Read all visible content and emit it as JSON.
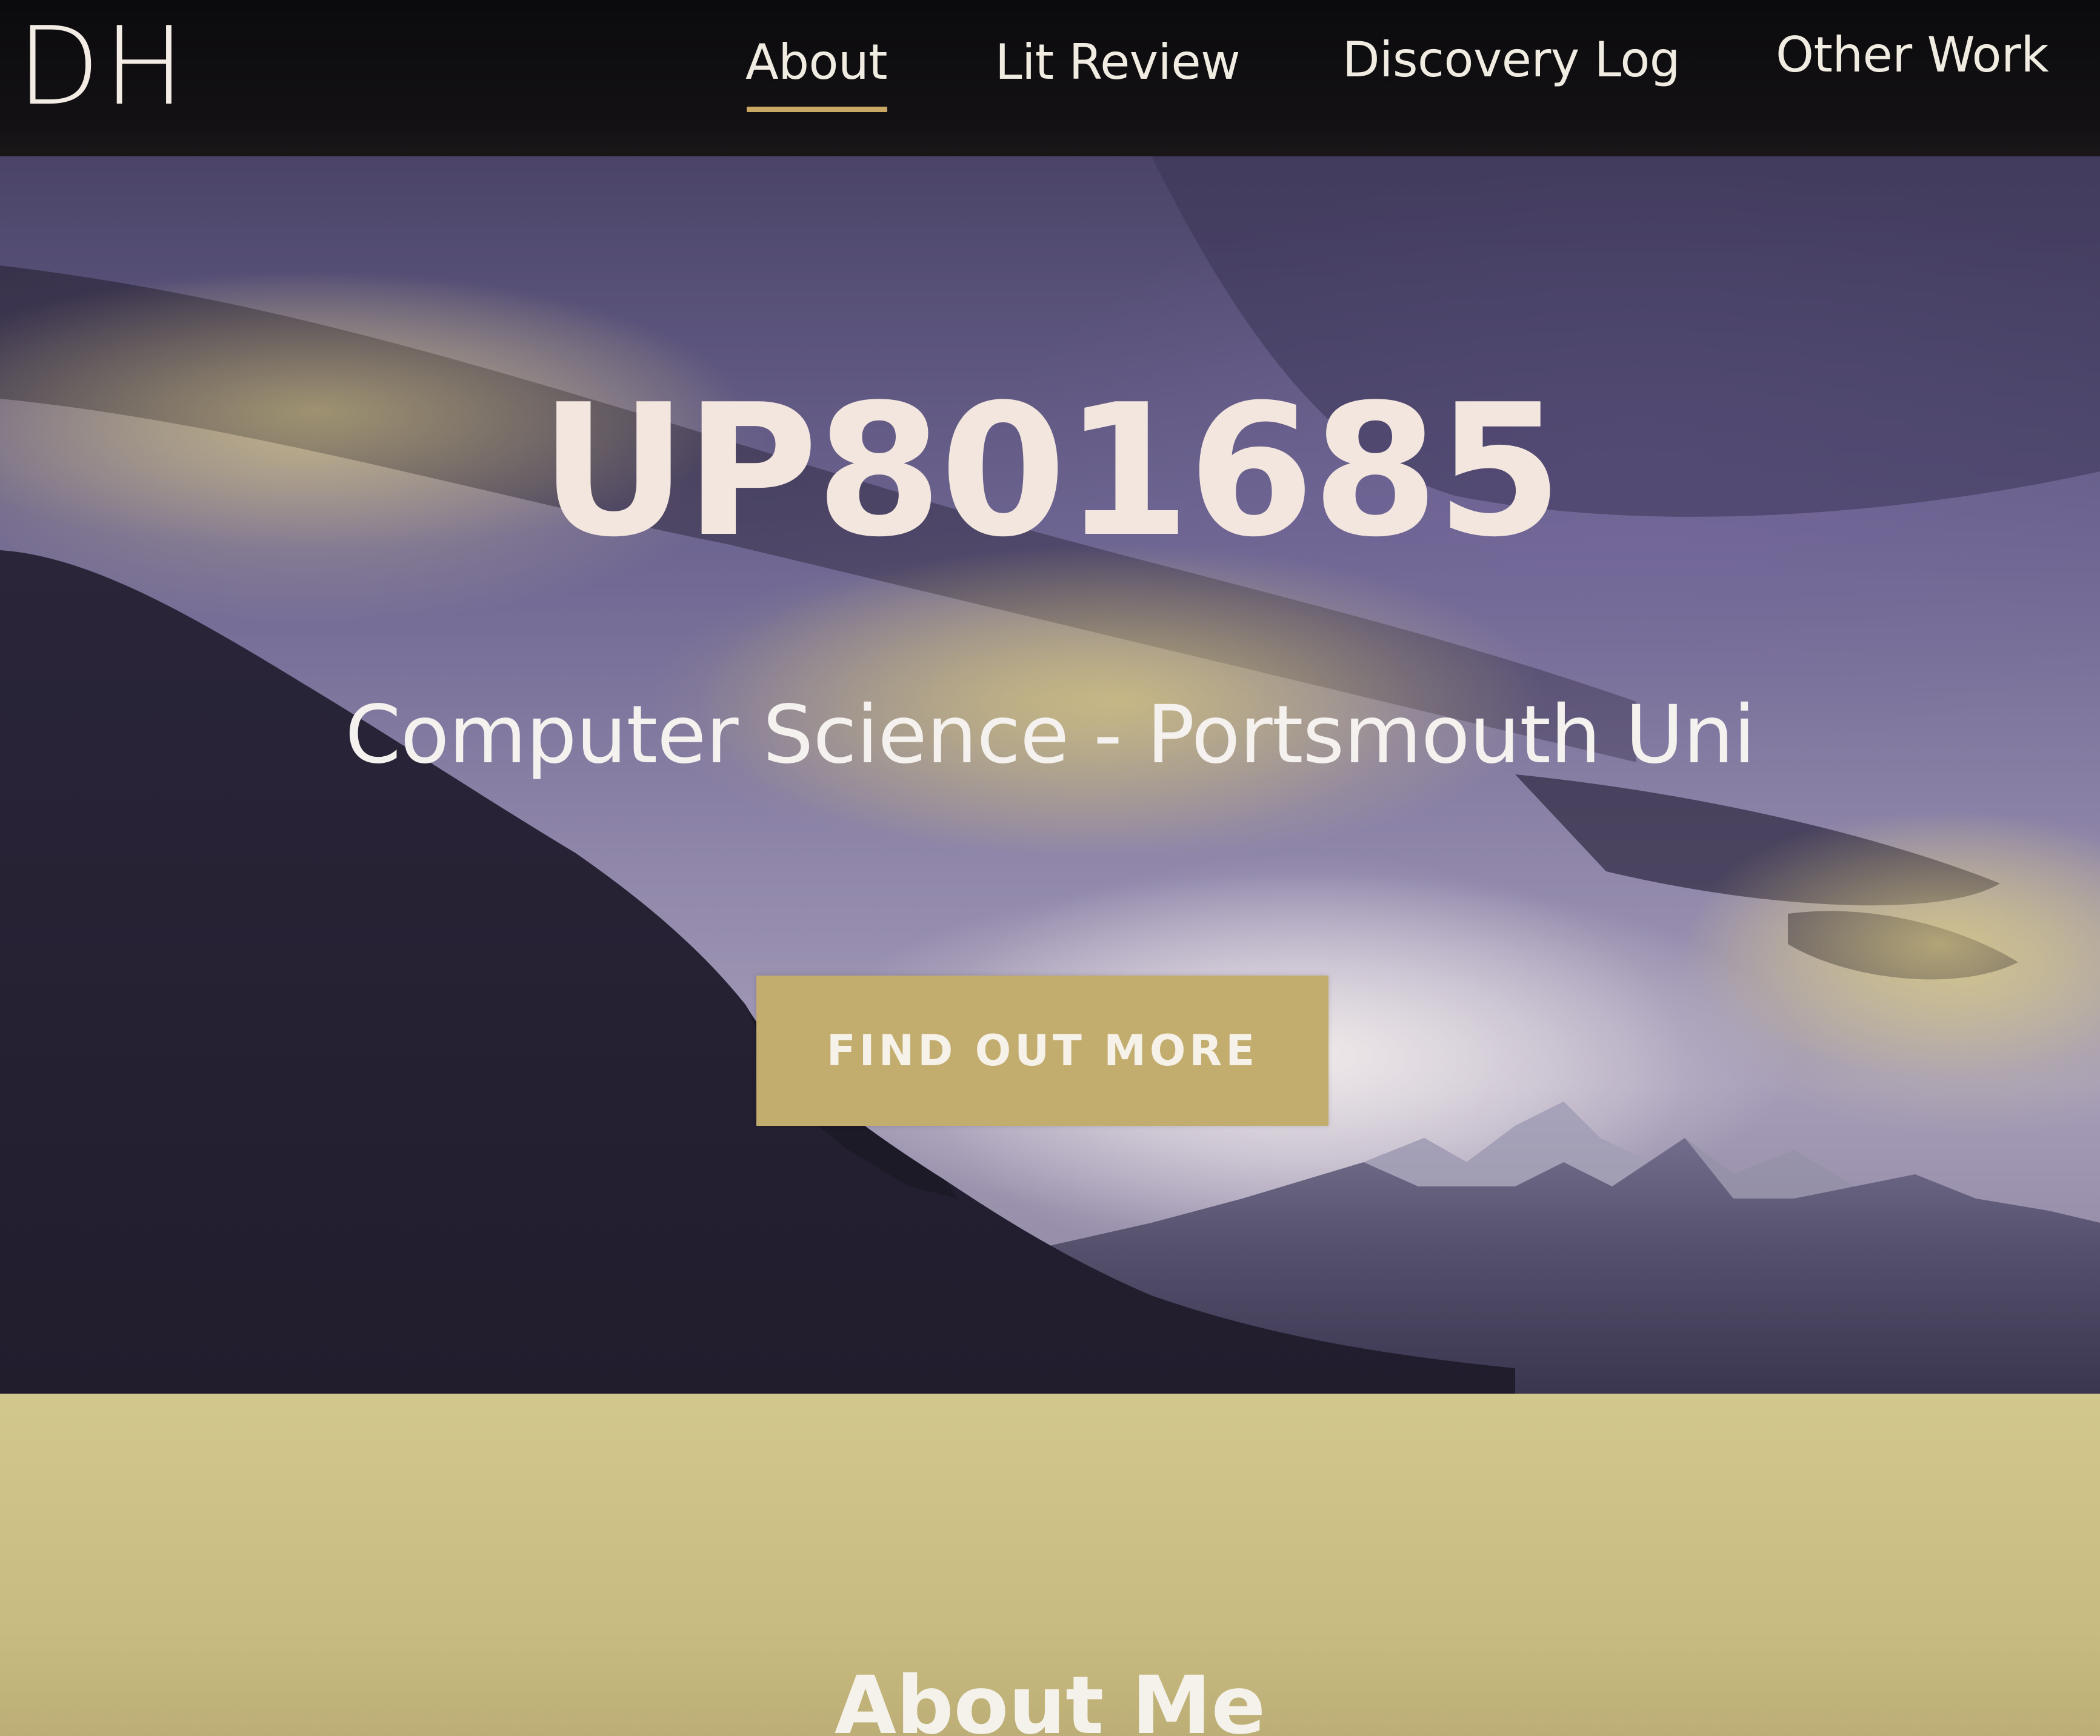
{
  "nav": {
    "brand": "DH",
    "links": [
      "About",
      "Lit Review",
      "Discovery Log",
      "Other Work"
    ],
    "active": "About",
    "accent_color": "#c8a862"
  },
  "hero": {
    "title": "UP801685",
    "subtitle": "Computer Science - Portsmouth Uni",
    "button_label": "FIND OUT MORE",
    "button_color": "#c2ad6e"
  },
  "about": {
    "heading": "About Me",
    "background_color": "#cdc084"
  }
}
